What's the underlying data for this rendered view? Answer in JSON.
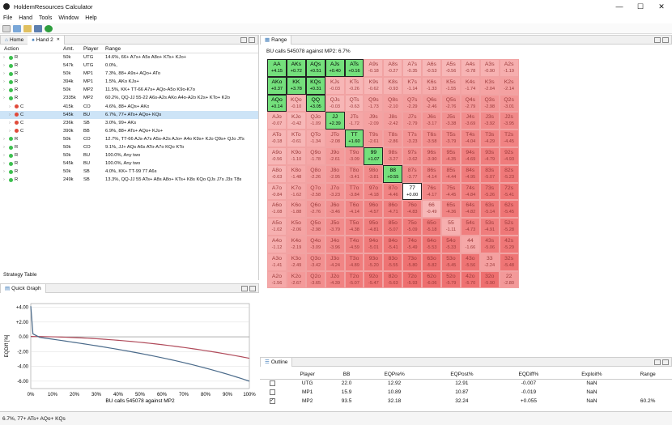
{
  "window": {
    "title": "HoldemResources Calculator",
    "minimize": "—",
    "maximize": "☐",
    "close": "✕"
  },
  "menu": [
    "File",
    "Hand",
    "Tools",
    "Window",
    "Help"
  ],
  "left_tabs": {
    "home": "Home",
    "hand2": "Hand 2",
    "close": "✕"
  },
  "action_columns": {
    "action": "Action",
    "amt": "Amt.",
    "player": "Player",
    "range": "Range"
  },
  "actions": [
    {
      "type": "R",
      "amt": "50k",
      "player": "UTG",
      "range": "14.6%, 66+ A7s+ A5s A8o+ KTs+ KJo+",
      "indent": 0,
      "color": "#3cbf4e",
      "sel": false
    },
    {
      "type": "R",
      "amt": "547k",
      "player": "UTG",
      "range": "0.0%,",
      "indent": 0,
      "color": "#3cbf4e",
      "sel": false
    },
    {
      "type": "R",
      "amt": "50k",
      "player": "MP1",
      "range": "7.3%, 88+ A9s+ AQo+ ATo",
      "indent": 0,
      "color": "#3cbf4e",
      "sel": false
    },
    {
      "type": "R",
      "amt": "394k",
      "player": "MP1",
      "range": "1.5%, AKo KJs+",
      "indent": 0,
      "color": "#3cbf4e",
      "sel": false
    },
    {
      "type": "R",
      "amt": "50k",
      "player": "MP2",
      "range": "11.5%, KK+ TT-66 A7s+ AQo-A5o K9o-K7o",
      "indent": 0,
      "color": "#3cbf4e",
      "sel": false
    },
    {
      "type": "R",
      "amt": "2335k",
      "player": "MP2",
      "range": "60.2%, QQ-JJ 55-22 A6s-A2s AKo A4o-A2o K2s+ KTo+ K2o",
      "indent": 0,
      "color": "#3cbf4e",
      "sel": false
    },
    {
      "type": "C",
      "amt": "415k",
      "player": "CO",
      "range": "4.6%, 88+ AQs+ AKo",
      "indent": 1,
      "color": "#e04a3a",
      "sel": false
    },
    {
      "type": "C",
      "amt": "545k",
      "player": "BU",
      "range": "6.7%, 77+ ATs+ AQo+ KQs",
      "indent": 1,
      "color": "#e04a3a",
      "sel": true
    },
    {
      "type": "C",
      "amt": "236k",
      "player": "SB",
      "range": "3.0%, 99+ AKs",
      "indent": 1,
      "color": "#e04a3a",
      "sel": false
    },
    {
      "type": "C",
      "amt": "390k",
      "player": "BB",
      "range": "6.9%, 88+ ATs+ AQo+ KJs+",
      "indent": 1,
      "color": "#e04a3a",
      "sel": false
    },
    {
      "type": "R",
      "amt": "50k",
      "player": "CO",
      "range": "12.7%, TT-66 AJs-A7s A5s-A2s AJo+ A4o K9s+ KJo Q9s+ QJo JTs",
      "indent": 0,
      "color": "#3cbf4e",
      "sel": false
    },
    {
      "type": "R",
      "amt": "50k",
      "player": "CO",
      "range": "9.1%, JJ+ AQs A6s ATo-A7o KQo KTo",
      "indent": 0,
      "color": "#3cbf4e",
      "sel": false
    },
    {
      "type": "R",
      "amt": "50k",
      "player": "BU",
      "range": "100.0%, Any two",
      "indent": 0,
      "color": "#3cbf4e",
      "sel": false
    },
    {
      "type": "R",
      "amt": "545k",
      "player": "BU",
      "range": "100.0%, Any two",
      "indent": 0,
      "color": "#3cbf4e",
      "sel": false
    },
    {
      "type": "R",
      "amt": "50k",
      "player": "SB",
      "range": "4.0%, KK+ TT-99 77 A6s",
      "indent": 0,
      "color": "#3cbf4e",
      "sel": false
    },
    {
      "type": "R",
      "amt": "249k",
      "player": "SB",
      "range": "13.3%, QQ-JJ 55 ATs+ A8s A8o+ KTs+ K8s KQo QJs J7s J3s T8s",
      "indent": 0,
      "color": "#3cbf4e",
      "sel": false
    }
  ],
  "strategy_tab": "Strategy Table",
  "quickgraph_tab": "Quick Graph",
  "range_tab": "Range",
  "range_subtitle": "BU calls 545078 against MP2: 6.7%",
  "grid": [
    [
      [
        "AA",
        "+4.15"
      ],
      [
        "AKs",
        "+0.72"
      ],
      [
        "AQs",
        "+0.51"
      ],
      [
        "AJs",
        "+0.40"
      ],
      [
        "ATs",
        "+0.16"
      ],
      [
        "A9s",
        "-0.18"
      ],
      [
        "A8s",
        "-0.27"
      ],
      [
        "A7s",
        "-0.35"
      ],
      [
        "A6s",
        "-0.53"
      ],
      [
        "A5s",
        "-0.56"
      ],
      [
        "A4s",
        "-0.78"
      ],
      [
        "A3s",
        "-0.90"
      ],
      [
        "A2s",
        "-1.19"
      ]
    ],
    [
      [
        "AKo",
        "+0.37"
      ],
      [
        "KK",
        "+3.78"
      ],
      [
        "KQs",
        "+0.31"
      ],
      [
        "KJs",
        "-0.03"
      ],
      [
        "KTs",
        "-0.26"
      ],
      [
        "K9s",
        "-0.62"
      ],
      [
        "K8s",
        "-0.93"
      ],
      [
        "K7s",
        "-1.14"
      ],
      [
        "K6s",
        "-1.33"
      ],
      [
        "K5s",
        "-1.55"
      ],
      [
        "K4s",
        "-1.74"
      ],
      [
        "K3s",
        "-2.04"
      ],
      [
        "K2s",
        "-2.14"
      ]
    ],
    [
      [
        "AQo",
        "+0.14"
      ],
      [
        "KQo",
        "-0.10"
      ],
      [
        "QQ",
        "+3.05"
      ],
      [
        "QJs",
        "-0.03"
      ],
      [
        "QTs",
        "-0.63"
      ],
      [
        "Q9s",
        "-1.73"
      ],
      [
        "Q8s",
        "-2.10"
      ],
      [
        "Q7s",
        "-2.29"
      ],
      [
        "Q6s",
        "-2.46"
      ],
      [
        "Q5s",
        "-2.76"
      ],
      [
        "Q4s",
        "-2.79"
      ],
      [
        "Q3s",
        "-2.98"
      ],
      [
        "Q2s",
        "-3.01"
      ]
    ],
    [
      [
        "AJo",
        "-0.07"
      ],
      [
        "KJo",
        "-0.42"
      ],
      [
        "QJo",
        "-1.09"
      ],
      [
        "JJ",
        "+2.39"
      ],
      [
        "JTs",
        "-1.72"
      ],
      [
        "J9s",
        "-2.09"
      ],
      [
        "J8s",
        "-2.42"
      ],
      [
        "J7s",
        "-2.79"
      ],
      [
        "J6s",
        "-3.17"
      ],
      [
        "J5s",
        "-3.38"
      ],
      [
        "J4s",
        "-3.69"
      ],
      [
        "J3s",
        "-3.92"
      ],
      [
        "J2s",
        "-3.95"
      ]
    ],
    [
      [
        "ATo",
        "-0.18"
      ],
      [
        "KTo",
        "-0.61"
      ],
      [
        "QTo",
        "-1.34"
      ],
      [
        "JTo",
        "-2.08"
      ],
      [
        "TT",
        "+1.60"
      ],
      [
        "T9s",
        "-2.61"
      ],
      [
        "T8s",
        "-2.86"
      ],
      [
        "T7s",
        "-3.23"
      ],
      [
        "T6s",
        "-3.58"
      ],
      [
        "T5s",
        "-3.79"
      ],
      [
        "T4s",
        "-4.04"
      ],
      [
        "T3s",
        "-4.29"
      ],
      [
        "T2s",
        "-4.45"
      ]
    ],
    [
      [
        "A9o",
        "-0.56"
      ],
      [
        "K9o",
        "-1.10"
      ],
      [
        "Q9o",
        "-1.78"
      ],
      [
        "J9o",
        "-2.61"
      ],
      [
        "T9o",
        "-3.09"
      ],
      [
        "99",
        "+1.07"
      ],
      [
        "98s",
        "-3.27"
      ],
      [
        "97s",
        "-3.62"
      ],
      [
        "96s",
        "-3.90"
      ],
      [
        "95s",
        "-4.35"
      ],
      [
        "94s",
        "-4.69"
      ],
      [
        "93s",
        "-4.79"
      ],
      [
        "92s",
        "-4.93"
      ]
    ],
    [
      [
        "A8o",
        "-0.63"
      ],
      [
        "K8o",
        "-1.48"
      ],
      [
        "Q8o",
        "-2.26"
      ],
      [
        "J8o",
        "-2.95"
      ],
      [
        "T8o",
        "-3.41"
      ],
      [
        "98o",
        "-3.81"
      ],
      [
        "88",
        "+0.55"
      ],
      [
        "87s",
        "-3.77"
      ],
      [
        "86s",
        "-4.14"
      ],
      [
        "85s",
        "-4.44"
      ],
      [
        "84s",
        "-4.95"
      ],
      [
        "83s",
        "-5.07"
      ],
      [
        "82s",
        "-5.23"
      ]
    ],
    [
      [
        "A7o",
        "-0.84"
      ],
      [
        "K7o",
        "-1.62"
      ],
      [
        "Q7o",
        "-2.58"
      ],
      [
        "J7o",
        "-3.23"
      ],
      [
        "T7o",
        "-3.84"
      ],
      [
        "97o",
        "-4.18"
      ],
      [
        "87o",
        "-4.46"
      ],
      [
        "77",
        "+0.00"
      ],
      [
        "76s",
        "-4.17"
      ],
      [
        "75s",
        "-4.45"
      ],
      [
        "74s",
        "-4.84"
      ],
      [
        "73s",
        "-5.26"
      ],
      [
        "72s",
        "-5.41"
      ]
    ],
    [
      [
        "A6o",
        "-1.08"
      ],
      [
        "K6o",
        "-1.88"
      ],
      [
        "Q6o",
        "-2.76"
      ],
      [
        "J6o",
        "-3.46"
      ],
      [
        "T6o",
        "-4.14"
      ],
      [
        "96o",
        "-4.57"
      ],
      [
        "86o",
        "-4.71"
      ],
      [
        "76o",
        "-4.83"
      ],
      [
        "66",
        "-0.49"
      ],
      [
        "65s",
        "-4.36"
      ],
      [
        "64s",
        "-4.82"
      ],
      [
        "63s",
        "-5.14"
      ],
      [
        "62s",
        "-5.45"
      ]
    ],
    [
      [
        "A5o",
        "-1.02"
      ],
      [
        "K5o",
        "-2.06"
      ],
      [
        "Q5o",
        "-2.98"
      ],
      [
        "J5o",
        "-3.79"
      ],
      [
        "T5o",
        "-4.38"
      ],
      [
        "95o",
        "-4.81"
      ],
      [
        "85o",
        "-5.07"
      ],
      [
        "75o",
        "-5.09"
      ],
      [
        "65o",
        "-5.18"
      ],
      [
        "55",
        "-1.11"
      ],
      [
        "54s",
        "-4.73"
      ],
      [
        "53s",
        "-4.91"
      ],
      [
        "52s",
        "-5.28"
      ]
    ],
    [
      [
        "A4o",
        "-1.12"
      ],
      [
        "K4o",
        "-2.19"
      ],
      [
        "Q4o",
        "-3.09"
      ],
      [
        "J4o",
        "-3.96"
      ],
      [
        "T4o",
        "-4.59"
      ],
      [
        "94o",
        "-5.01"
      ],
      [
        "84o",
        "-5.41"
      ],
      [
        "74o",
        "-5.49"
      ],
      [
        "64o",
        "-5.53"
      ],
      [
        "54o",
        "-5.33"
      ],
      [
        "44",
        "-1.66"
      ],
      [
        "43s",
        "-5.06"
      ],
      [
        "42s",
        "-5.29"
      ]
    ],
    [
      [
        "A3o",
        "-1.41"
      ],
      [
        "K3o",
        "-2.49"
      ],
      [
        "Q3o",
        "-3.42"
      ],
      [
        "J3o",
        "-4.24"
      ],
      [
        "T3o",
        "-4.89"
      ],
      [
        "93o",
        "-5.20"
      ],
      [
        "83o",
        "-5.55"
      ],
      [
        "73o",
        "-5.80"
      ],
      [
        "63o",
        "-5.82"
      ],
      [
        "53o",
        "-5.45"
      ],
      [
        "43o",
        "-5.56"
      ],
      [
        "33",
        "-2.24"
      ],
      [
        "32s",
        "-5.48"
      ]
    ],
    [
      [
        "A2o",
        "-1.56"
      ],
      [
        "K2o",
        "-2.67"
      ],
      [
        "Q2o",
        "-3.65"
      ],
      [
        "J2o",
        "-4.39"
      ],
      [
        "T2o",
        "-5.07"
      ],
      [
        "92o",
        "-5.47"
      ],
      [
        "82o",
        "-5.63"
      ],
      [
        "72o",
        "-5.93"
      ],
      [
        "62o",
        "-6.06"
      ],
      [
        "52o",
        "-5.79"
      ],
      [
        "42o",
        "-5.70"
      ],
      [
        "32o",
        "-5.90"
      ],
      [
        "22",
        "-2.80"
      ]
    ]
  ],
  "quick_graph": {
    "ylabel": "EQDiff [%]",
    "xlabel": "BU calls 545078 against MP2",
    "yticks": [
      "+4.00",
      "+2.00",
      "0.00",
      "-2.00",
      "-4.00",
      "-6.00"
    ],
    "xticks": [
      "0%",
      "10%",
      "20%",
      "30%",
      "40%",
      "50%",
      "60%",
      "70%",
      "80%",
      "90%",
      "100%"
    ],
    "colors": {
      "blue": "#4a6a8a",
      "red": "#b04a5a"
    }
  },
  "outline": {
    "tab": "Outline",
    "headers": [
      "Player",
      "BB",
      "EQPre%",
      "EQPost%",
      "EQDiff%",
      "Exploit%",
      "Range"
    ],
    "rows": [
      {
        "checked": false,
        "player": "UTG",
        "bb": "22.0",
        "pre": "12.92",
        "post": "12.91",
        "diff": "-0.007",
        "exploit": "NaN",
        "range": ""
      },
      {
        "checked": false,
        "player": "MP1",
        "bb": "15.9",
        "pre": "10.89",
        "post": "10.87",
        "diff": "-0.019",
        "exploit": "NaN",
        "range": ""
      },
      {
        "checked": true,
        "player": "MP2",
        "bb": "93.5",
        "pre": "32.18",
        "post": "32.24",
        "diff": "+0.055",
        "exploit": "NaN",
        "range": "60.2%"
      }
    ]
  },
  "status_text": "6.7%, 77+ ATs+ AQo+ KQs"
}
